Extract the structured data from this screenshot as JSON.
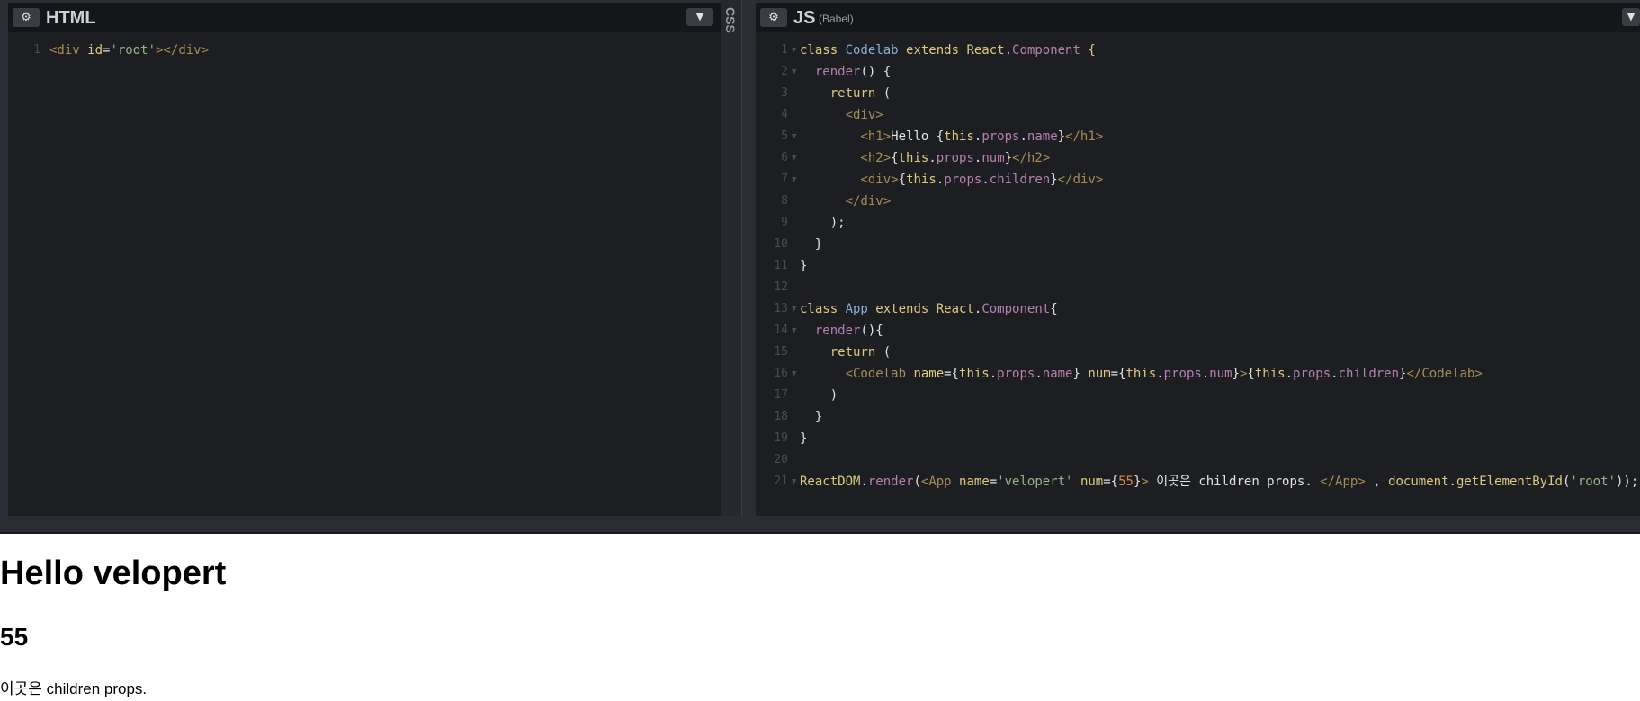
{
  "html_pane": {
    "title": "HTML",
    "lines": [
      {
        "n": "1",
        "fold": false,
        "t": [
          [
            "tag",
            "<div "
          ],
          [
            "attr",
            "id"
          ],
          [
            "txt",
            "="
          ],
          [
            "str",
            "'root'"
          ],
          [
            "tag",
            "></div>"
          ]
        ]
      }
    ]
  },
  "css_pane": {
    "title": "CSS"
  },
  "js_pane": {
    "title": "JS",
    "subtitle": "(Babel)",
    "lines": [
      {
        "n": "1",
        "fold": true,
        "t": [
          [
            "kw",
            "class "
          ],
          [
            "cls",
            "Codelab "
          ],
          [
            "kw",
            "extends "
          ],
          [
            "kw",
            "React"
          ],
          [
            "txt",
            "."
          ],
          [
            "prop",
            "Component "
          ],
          [
            "kw",
            "{"
          ]
        ]
      },
      {
        "n": "2",
        "fold": true,
        "t": [
          [
            "txt",
            "  "
          ],
          [
            "prop",
            "render"
          ],
          [
            "txt",
            "() {"
          ]
        ]
      },
      {
        "n": "3",
        "fold": false,
        "t": [
          [
            "txt",
            "    "
          ],
          [
            "kw",
            "return"
          ],
          [
            "txt",
            " ("
          ]
        ]
      },
      {
        "n": "4",
        "fold": false,
        "t": [
          [
            "txt",
            "      "
          ],
          [
            "tag",
            "<div>"
          ]
        ]
      },
      {
        "n": "5",
        "fold": true,
        "t": [
          [
            "txt",
            "        "
          ],
          [
            "tag",
            "<h1>"
          ],
          [
            "txt",
            "Hello {"
          ],
          [
            "kw",
            "this"
          ],
          [
            "txt",
            "."
          ],
          [
            "prop",
            "props"
          ],
          [
            "txt",
            "."
          ],
          [
            "prop",
            "name"
          ],
          [
            "txt",
            "}"
          ],
          [
            "tag",
            "</h1>"
          ]
        ]
      },
      {
        "n": "6",
        "fold": true,
        "t": [
          [
            "txt",
            "        "
          ],
          [
            "tag",
            "<h2>"
          ],
          [
            "txt",
            "{"
          ],
          [
            "kw",
            "this"
          ],
          [
            "txt",
            "."
          ],
          [
            "prop",
            "props"
          ],
          [
            "txt",
            "."
          ],
          [
            "prop",
            "num"
          ],
          [
            "txt",
            "}"
          ],
          [
            "tag",
            "</h2>"
          ]
        ]
      },
      {
        "n": "7",
        "fold": true,
        "t": [
          [
            "txt",
            "        "
          ],
          [
            "tag",
            "<div>"
          ],
          [
            "txt",
            "{"
          ],
          [
            "kw",
            "this"
          ],
          [
            "txt",
            "."
          ],
          [
            "prop",
            "props"
          ],
          [
            "txt",
            "."
          ],
          [
            "prop",
            "children"
          ],
          [
            "txt",
            "}"
          ],
          [
            "tag",
            "</div>"
          ]
        ]
      },
      {
        "n": "8",
        "fold": false,
        "t": [
          [
            "txt",
            "      "
          ],
          [
            "tag",
            "</div>"
          ]
        ]
      },
      {
        "n": "9",
        "fold": false,
        "t": [
          [
            "txt",
            "    );"
          ]
        ]
      },
      {
        "n": "10",
        "fold": false,
        "t": [
          [
            "txt",
            "  }"
          ]
        ]
      },
      {
        "n": "11",
        "fold": false,
        "t": [
          [
            "txt",
            "}"
          ]
        ]
      },
      {
        "n": "12",
        "fold": false,
        "t": []
      },
      {
        "n": "13",
        "fold": true,
        "t": [
          [
            "kw",
            "class "
          ],
          [
            "cls",
            "App "
          ],
          [
            "kw",
            "extends "
          ],
          [
            "kw",
            "React"
          ],
          [
            "txt",
            "."
          ],
          [
            "prop",
            "Component"
          ],
          [
            "txt",
            "{"
          ]
        ]
      },
      {
        "n": "14",
        "fold": true,
        "t": [
          [
            "txt",
            "  "
          ],
          [
            "prop",
            "render"
          ],
          [
            "txt",
            "(){"
          ]
        ]
      },
      {
        "n": "15",
        "fold": false,
        "t": [
          [
            "txt",
            "    "
          ],
          [
            "kw",
            "return"
          ],
          [
            "txt",
            " ("
          ]
        ]
      },
      {
        "n": "16",
        "fold": true,
        "t": [
          [
            "txt",
            "      "
          ],
          [
            "tag",
            "<Codelab "
          ],
          [
            "attr",
            "name"
          ],
          [
            "txt",
            "={"
          ],
          [
            "kw",
            "this"
          ],
          [
            "txt",
            "."
          ],
          [
            "prop",
            "props"
          ],
          [
            "txt",
            "."
          ],
          [
            "prop",
            "name"
          ],
          [
            "txt",
            "} "
          ],
          [
            "attr",
            "num"
          ],
          [
            "txt",
            "={"
          ],
          [
            "kw",
            "this"
          ],
          [
            "txt",
            "."
          ],
          [
            "prop",
            "props"
          ],
          [
            "txt",
            "."
          ],
          [
            "prop",
            "num"
          ],
          [
            "txt",
            "}"
          ],
          [
            "tag",
            ">"
          ],
          [
            "txt",
            "{"
          ],
          [
            "kw",
            "this"
          ],
          [
            "txt",
            "."
          ],
          [
            "prop",
            "props"
          ],
          [
            "txt",
            "."
          ],
          [
            "prop",
            "children"
          ],
          [
            "txt",
            "}"
          ],
          [
            "tag",
            "</Codelab>"
          ]
        ]
      },
      {
        "n": "17",
        "fold": false,
        "t": [
          [
            "txt",
            "    )"
          ]
        ]
      },
      {
        "n": "18",
        "fold": false,
        "t": [
          [
            "txt",
            "  }"
          ]
        ]
      },
      {
        "n": "19",
        "fold": false,
        "t": [
          [
            "txt",
            "}"
          ]
        ]
      },
      {
        "n": "20",
        "fold": false,
        "t": []
      },
      {
        "n": "21",
        "fold": true,
        "t": [
          [
            "kw",
            "ReactDOM"
          ],
          [
            "txt",
            "."
          ],
          [
            "prop",
            "render"
          ],
          [
            "txt",
            "("
          ],
          [
            "tag",
            "<App "
          ],
          [
            "attr",
            "name"
          ],
          [
            "txt",
            "="
          ],
          [
            "str",
            "'velopert'"
          ],
          [
            "txt",
            " "
          ],
          [
            "attr",
            "num"
          ],
          [
            "txt",
            "={"
          ],
          [
            "num",
            "55"
          ],
          [
            "txt",
            "}"
          ],
          [
            "tag",
            ">"
          ],
          [
            "txt",
            " 이곳은 children props. "
          ],
          [
            "tag",
            "</App>"
          ],
          [
            "txt",
            " , "
          ],
          [
            "kw",
            "document"
          ],
          [
            "txt",
            "."
          ],
          [
            "kw",
            "getElementById"
          ],
          [
            "txt",
            "("
          ],
          [
            "str",
            "'root'"
          ],
          [
            "txt",
            "));"
          ]
        ]
      }
    ]
  },
  "preview": {
    "heading": "Hello velopert",
    "number": "55",
    "children": "이곳은 children props."
  },
  "colors": {
    "editor_bg": "#1d1e22",
    "header_bg": "#151619",
    "keyword": "#ddca7e",
    "class_name": "#88afd5",
    "property": "#b681b1",
    "tag": "#a88c54",
    "string": "#96b38a",
    "number": "#e0853c"
  }
}
